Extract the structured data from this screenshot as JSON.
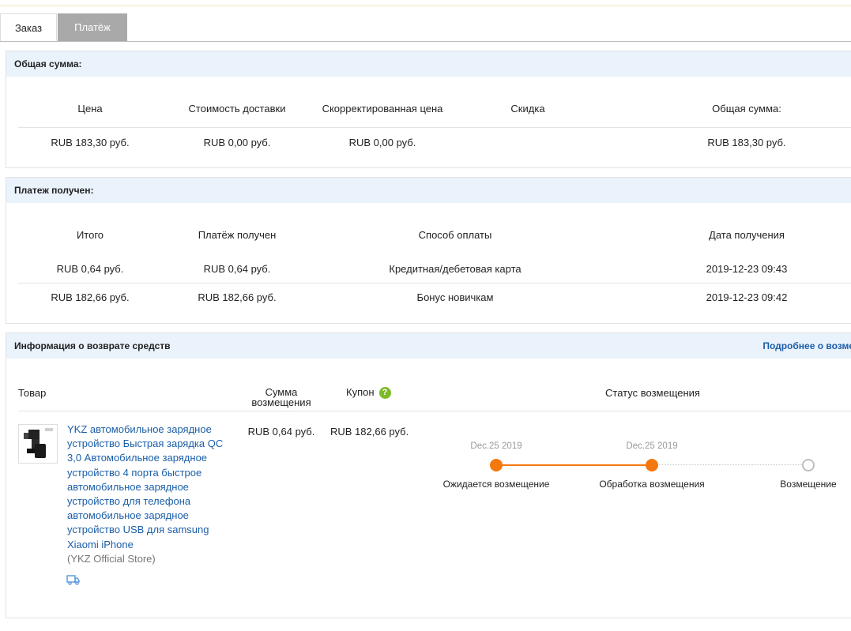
{
  "tabs": {
    "order": "Заказ",
    "payment": "Платёж"
  },
  "total": {
    "title": "Общая сумма:",
    "headers": [
      "Цена",
      "Стоимость доставки",
      "Скорректированная цена",
      "Скидка",
      "Общая сумма:"
    ],
    "row": [
      "RUB 183,30 руб.",
      "RUB 0,00 руб.",
      "RUB 0,00 руб.",
      "",
      "RUB 183,30 руб."
    ]
  },
  "payment": {
    "title": "Платеж получен:",
    "headers": [
      "Итого",
      "Платёж получен",
      "Способ оплаты",
      "Дата получения"
    ],
    "rows": [
      [
        "RUB 0,64 руб.",
        "RUB 0,64 руб.",
        "Кредитная/дебетовая карта",
        "2019-12-23 09:43"
      ],
      [
        "RUB 182,66 руб.",
        "RUB 182,66 руб.",
        "Бонус новичкам",
        "2019-12-23 09:42"
      ]
    ]
  },
  "refund": {
    "title": "Информация о возврате средств",
    "more_link": "Подробнее о возме",
    "headers": {
      "product": "Товар",
      "amount_line1": "Сумма",
      "amount_line2": "возмещения",
      "coupon": "Купон",
      "coupon_help": "?",
      "status": "Статус возмещения"
    },
    "item": {
      "title": "YKZ автомобильное зарядное устройство Быстрая зарядка QC 3,0 Автомобильное зарядное устройство 4 порта быстрое автомобильное зарядное устройство для телефона автомобильное зарядное устройство USB для samsung Xiaomi iPhone",
      "store": "(YKZ Official Store)",
      "amount": "RUB 0,64 руб.",
      "coupon": "RUB 182,66 руб."
    },
    "timeline": [
      {
        "date": "Dec.25 2019",
        "label": "Ожидается возмещение",
        "done": true
      },
      {
        "date": "Dec.25 2019",
        "label": "Обработка возмещения",
        "done": true
      },
      {
        "date": "",
        "label": "Возмещение",
        "done": false
      }
    ],
    "colors": {
      "accent": "#f5780e",
      "link": "#1b5ea7",
      "coupon_icon": "#7dbb26"
    },
    "icons": {
      "product_image": "car-charger-product-image",
      "shipping": "truck-icon"
    }
  }
}
